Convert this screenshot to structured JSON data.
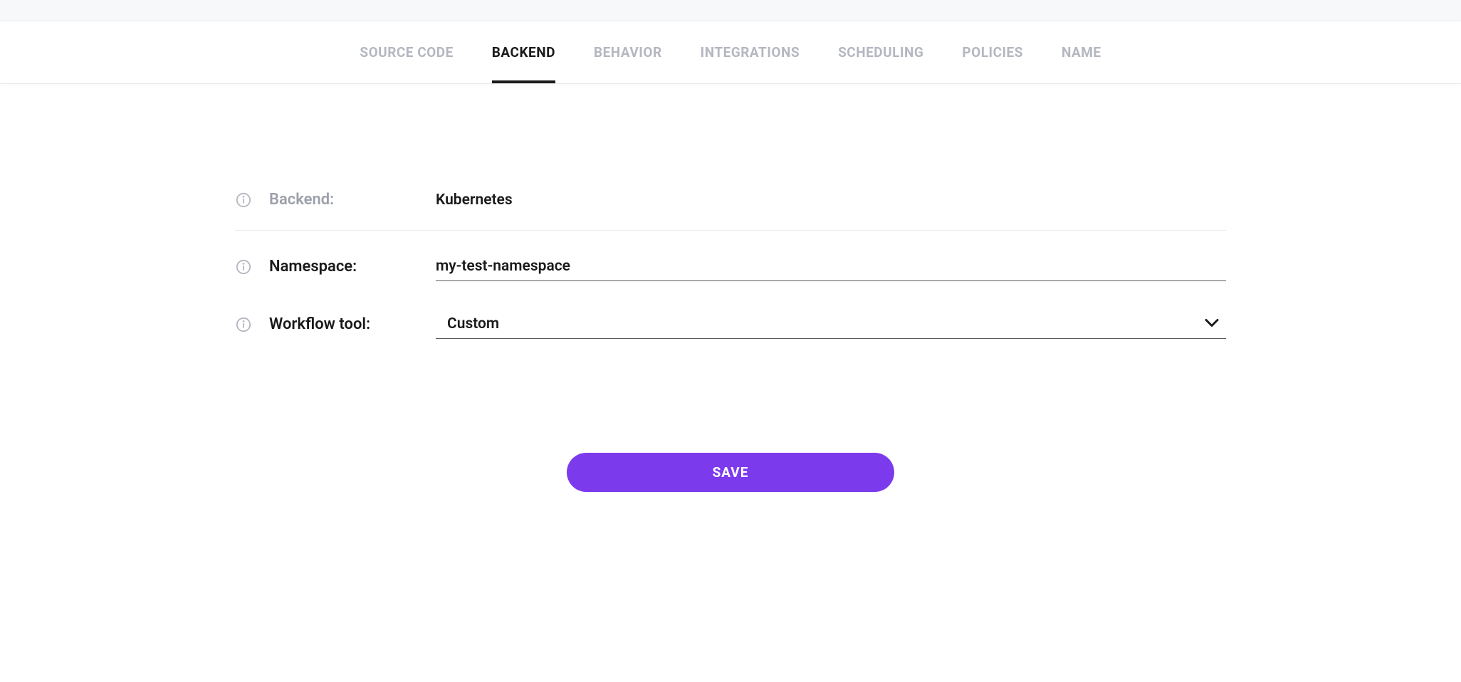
{
  "tabs": [
    {
      "label": "SOURCE CODE",
      "active": false
    },
    {
      "label": "BACKEND",
      "active": true
    },
    {
      "label": "BEHAVIOR",
      "active": false
    },
    {
      "label": "INTEGRATIONS",
      "active": false
    },
    {
      "label": "SCHEDULING",
      "active": false
    },
    {
      "label": "POLICIES",
      "active": false
    },
    {
      "label": "NAME",
      "active": false
    }
  ],
  "form": {
    "backend": {
      "label": "Backend:",
      "value": "Kubernetes"
    },
    "namespace": {
      "label": "Namespace:",
      "value": "my-test-namespace"
    },
    "workflowTool": {
      "label": "Workflow tool:",
      "value": "Custom"
    }
  },
  "actions": {
    "save": "SAVE"
  },
  "colors": {
    "accent": "#7c3aed"
  }
}
